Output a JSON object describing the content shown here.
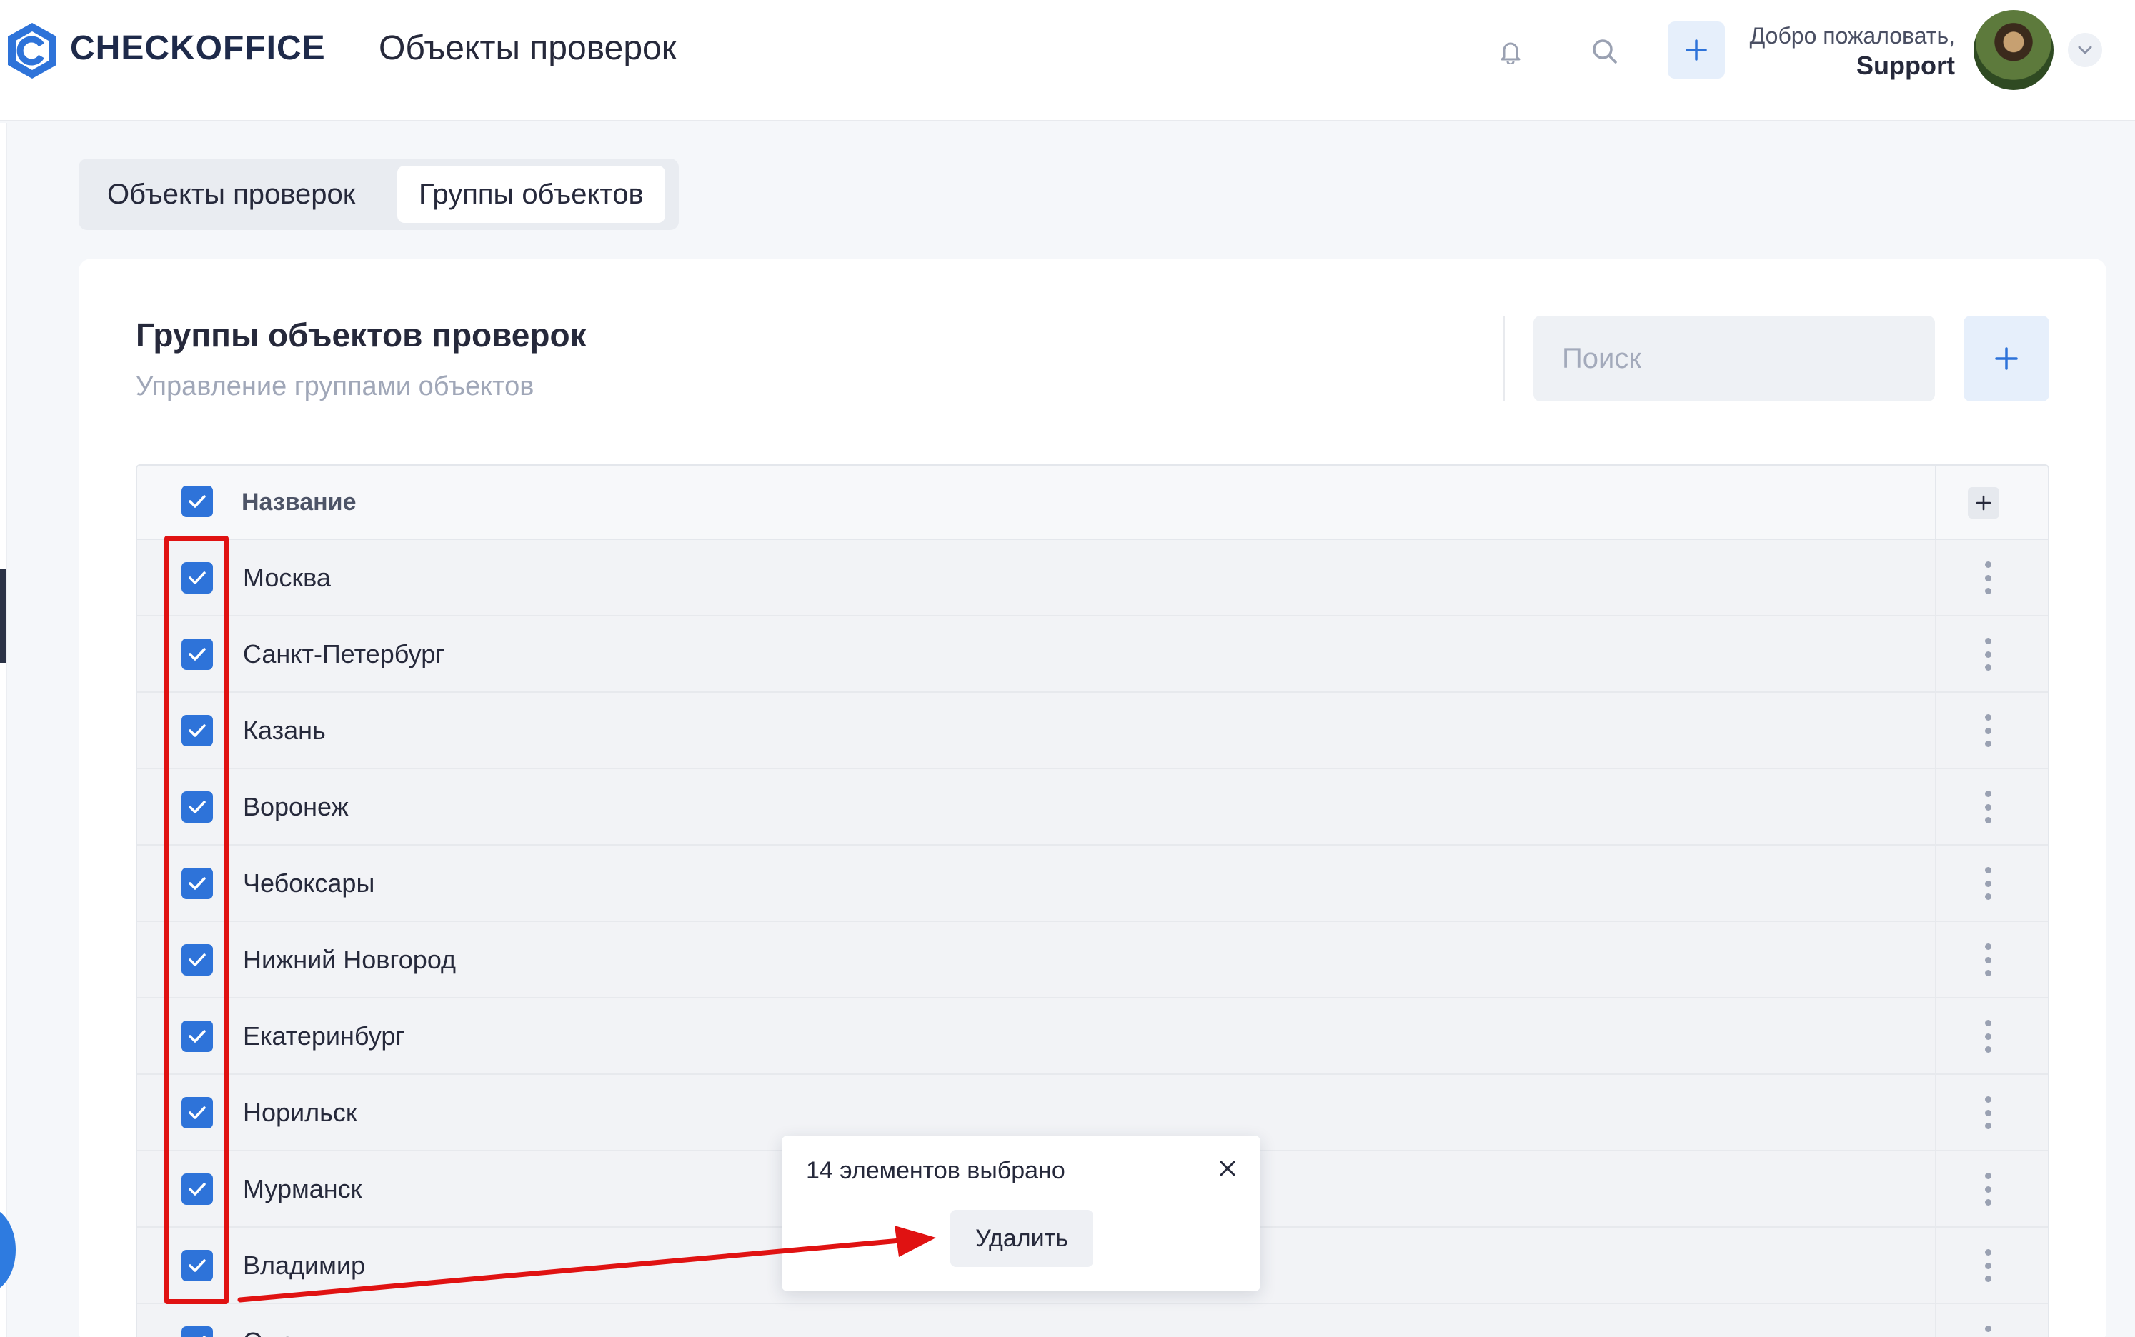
{
  "header": {
    "brand": "CHECKOFFICE",
    "page_title": "Объекты проверок",
    "welcome_greeting": "Добро пожаловать,",
    "user_name": "Support",
    "icons": [
      "logo-icon",
      "bell-icon",
      "search-icon",
      "plus-icon",
      "avatar",
      "chevron-down-icon"
    ]
  },
  "tabs": [
    {
      "label": "Объекты проверок",
      "active": false
    },
    {
      "label": "Группы объектов",
      "active": true
    }
  ],
  "card": {
    "title": "Группы объектов проверок",
    "subtitle": "Управление группами объектов",
    "search_placeholder": "Поиск"
  },
  "table": {
    "header_name": "Название",
    "header_checked": true,
    "rows": [
      {
        "name": "Москва",
        "checked": true
      },
      {
        "name": "Санкт-Петербург",
        "checked": true
      },
      {
        "name": "Казань",
        "checked": true
      },
      {
        "name": "Воронеж",
        "checked": true
      },
      {
        "name": "Чебоксары",
        "checked": true
      },
      {
        "name": "Нижний Новгород",
        "checked": true
      },
      {
        "name": "Екатеринбург",
        "checked": true
      },
      {
        "name": "Норильск",
        "checked": true
      },
      {
        "name": "Мурманск",
        "checked": true
      },
      {
        "name": "Владимир",
        "checked": true
      },
      {
        "name": "Омск",
        "checked": true
      }
    ]
  },
  "selection_popup": {
    "text": "14 элементов выбрано",
    "delete_label": "Удалить"
  },
  "colors": {
    "accent": "#2e73d9",
    "annotation": "#e01212",
    "brand": "#1e2a4a"
  }
}
